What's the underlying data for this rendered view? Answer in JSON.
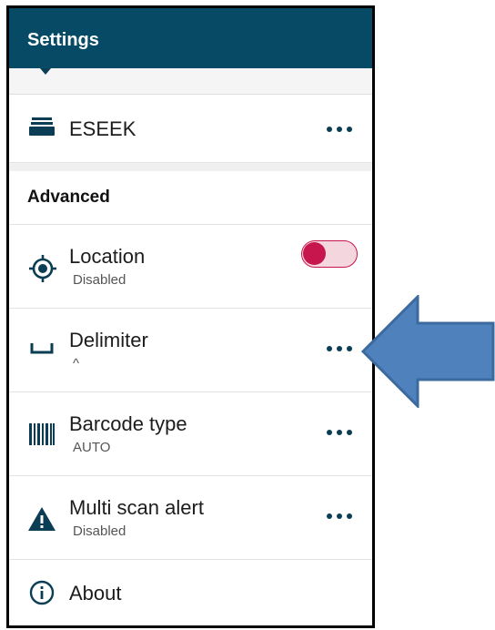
{
  "appbar": {
    "title": "Settings"
  },
  "items": [
    {
      "id": "eseek",
      "title": "ESEEK",
      "icon": "scanner-device-icon",
      "action": "more-options"
    },
    {
      "id": "location",
      "title": "Location",
      "subtitle": "Disabled",
      "icon": "gps-target-icon",
      "toggle_on": true
    },
    {
      "id": "delimiter",
      "title": "Delimiter",
      "subtitle": "^",
      "icon": "space-bar-icon",
      "action": "more-options"
    },
    {
      "id": "barcode",
      "title": "Barcode type",
      "subtitle": "AUTO",
      "icon": "barcode-icon",
      "action": "more-options"
    },
    {
      "id": "multiscan",
      "title": "Multi scan alert",
      "subtitle": "Disabled",
      "icon": "warning-triangle-icon",
      "action": "more-options"
    },
    {
      "id": "about",
      "title": "About",
      "icon": "info-circle-icon"
    }
  ],
  "sections": {
    "advanced": "Advanced"
  },
  "colors": {
    "appbar": "#064a66",
    "accent": "#c7164e",
    "icon": "#0b3e54",
    "annotation_arrow": "#4f81bd"
  }
}
